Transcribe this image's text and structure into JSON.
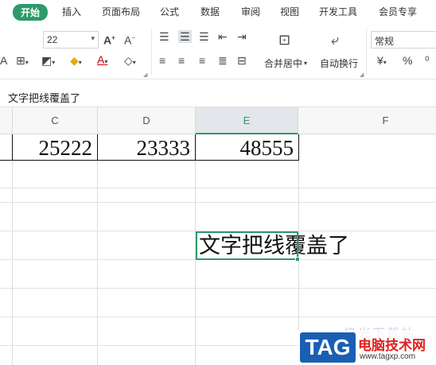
{
  "tabs": [
    {
      "label": "开始",
      "active": true
    },
    {
      "label": "插入"
    },
    {
      "label": "页面布局"
    },
    {
      "label": "公式"
    },
    {
      "label": "数据"
    },
    {
      "label": "审阅"
    },
    {
      "label": "视图"
    },
    {
      "label": "开发工具"
    },
    {
      "label": "会员专享"
    }
  ],
  "ribbon": {
    "font_size": "22",
    "number_format": "常规",
    "merge_label": "合并居中",
    "wrap_label": "自动换行",
    "currency_symbol": "¥",
    "percent_symbol": "%",
    "font_color_letter": "A",
    "grow_font": "A⁺",
    "shrink_font": "A⁻",
    "accent_color": "#2c9a6a"
  },
  "formula_bar": {
    "content": "文字把线覆盖了"
  },
  "sheet": {
    "columns": [
      "C",
      "D",
      "E",
      "F"
    ],
    "selected_column": "E",
    "row1": {
      "C": "25222",
      "D": "23333",
      "E": "48555"
    },
    "selected_cell_text": "文字把线覆盖了"
  },
  "watermark": {
    "faint": "极光下载站",
    "logo": "TAG",
    "site_name": "电脑技术网",
    "url": "www.tagxp.com"
  }
}
